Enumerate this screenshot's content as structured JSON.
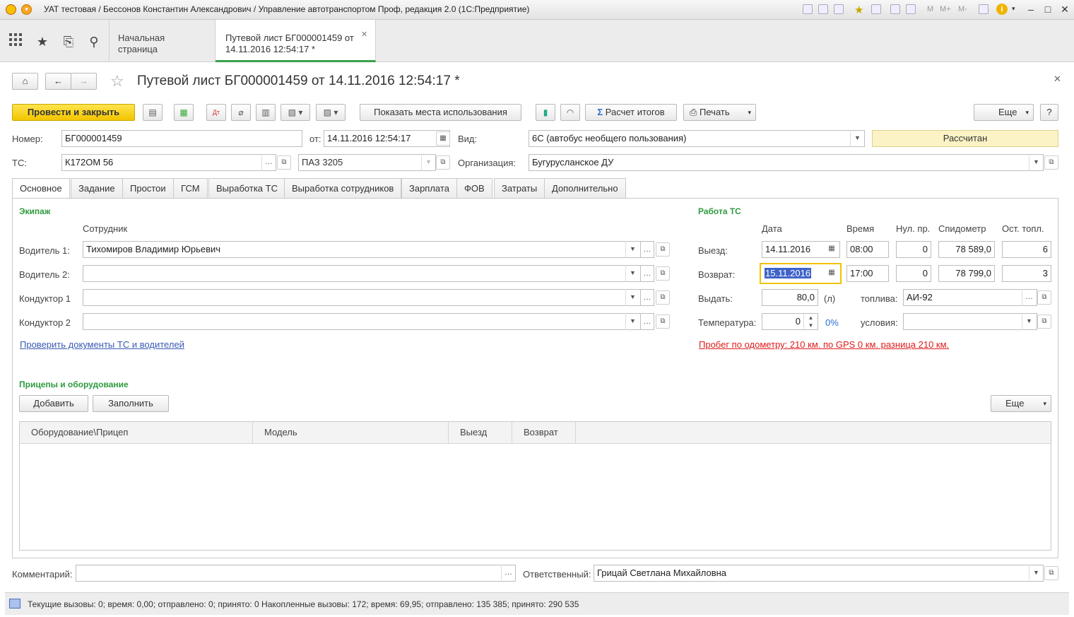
{
  "window": {
    "title": "УАТ тестовая / Бессонов Константин Александрович / Управление автотранспортом Проф, редакция 2.0  (1С:Предприятие)",
    "right_icons": [
      "M",
      "M+",
      "M-"
    ]
  },
  "tabs": [
    {
      "label": "Начальная страница"
    },
    {
      "label": "Путевой лист БГ000001459 от 14.11.2016 12:54:17 *"
    }
  ],
  "doc": {
    "title": "Путевой лист БГ000001459 от 14.11.2016 12:54:17 *"
  },
  "toolbar": {
    "post_close": "Провести и закрыть",
    "show_usage": "Показать места использования",
    "calc_totals": "Расчет итогов",
    "print": "Печать",
    "more": "Еще",
    "help": "?"
  },
  "header": {
    "number_label": "Номер:",
    "number": "БГ000001459",
    "from_label": "от:",
    "from": "14.11.2016 12:54:17",
    "kind_label": "Вид:",
    "kind": "6С (автобус необщего пользования)",
    "status": "Рассчитан",
    "ts_label": "ТС:",
    "ts": "К172ОМ 56",
    "ts_model": "ПАЗ 3205",
    "org_label": "Организация:",
    "org": "Бугурусланское ДУ"
  },
  "form_tabs": [
    "Основное",
    "Задание",
    "Простои",
    "ГСМ",
    "Выработка ТС",
    "Выработка сотрудников",
    "Зарплата",
    "ФОВ",
    "Затраты",
    "Дополнительно"
  ],
  "crew": {
    "title": "Экипаж",
    "col": "Сотрудник",
    "rows": [
      {
        "label": "Водитель 1:",
        "value": "Тихомиров Владимир Юрьевич"
      },
      {
        "label": "Водитель 2:",
        "value": ""
      },
      {
        "label": "Кондуктор 1",
        "value": ""
      },
      {
        "label": "Кондуктор 2",
        "value": ""
      }
    ],
    "check_link": "Проверить документы ТС и водителей"
  },
  "work": {
    "title": "Работа ТС",
    "cols": [
      "Дата",
      "Время",
      "Нул. пр.",
      "Спидометр",
      "Ост. топл."
    ],
    "out": {
      "label": "Выезд:",
      "date": "14.11.2016",
      "time": "08:00",
      "zero": "0",
      "speedo": "78 589,0",
      "fuel": "6"
    },
    "ret": {
      "label": "Возврат:",
      "date": "15.11.2016",
      "time": "17:00",
      "zero": "0",
      "speedo": "78 799,0",
      "fuel": "3"
    },
    "issue_label": "Выдать:",
    "issue": "80,0",
    "unit": "(л)",
    "fuel_label": "топлива:",
    "fuel": "АИ-92",
    "temp_label": "Температура:",
    "temp": "0",
    "pct": "0%",
    "cond_label": "условия:",
    "cond": "",
    "warning": "Пробег по одометру: 210 км. по GPS 0 км. разница 210 км."
  },
  "trailers": {
    "title": "Прицепы и оборудование",
    "add": "Добавить",
    "fill": "Заполнить",
    "more": "Еще",
    "cols": [
      "Оборудование\\Прицеп",
      "Модель",
      "Выезд",
      "Возврат"
    ]
  },
  "footer": {
    "comment_label": "Комментарий:",
    "comment": "",
    "resp_label": "Ответственный:",
    "resp": "Грицай Светлана Михайловна"
  },
  "status": {
    "text": "Текущие вызовы: 0; время: 0,00; отправлено: 0; принято: 0   Накопленные вызовы: 172; время: 69,95; отправлено: 135 385; принято: 290 535"
  }
}
